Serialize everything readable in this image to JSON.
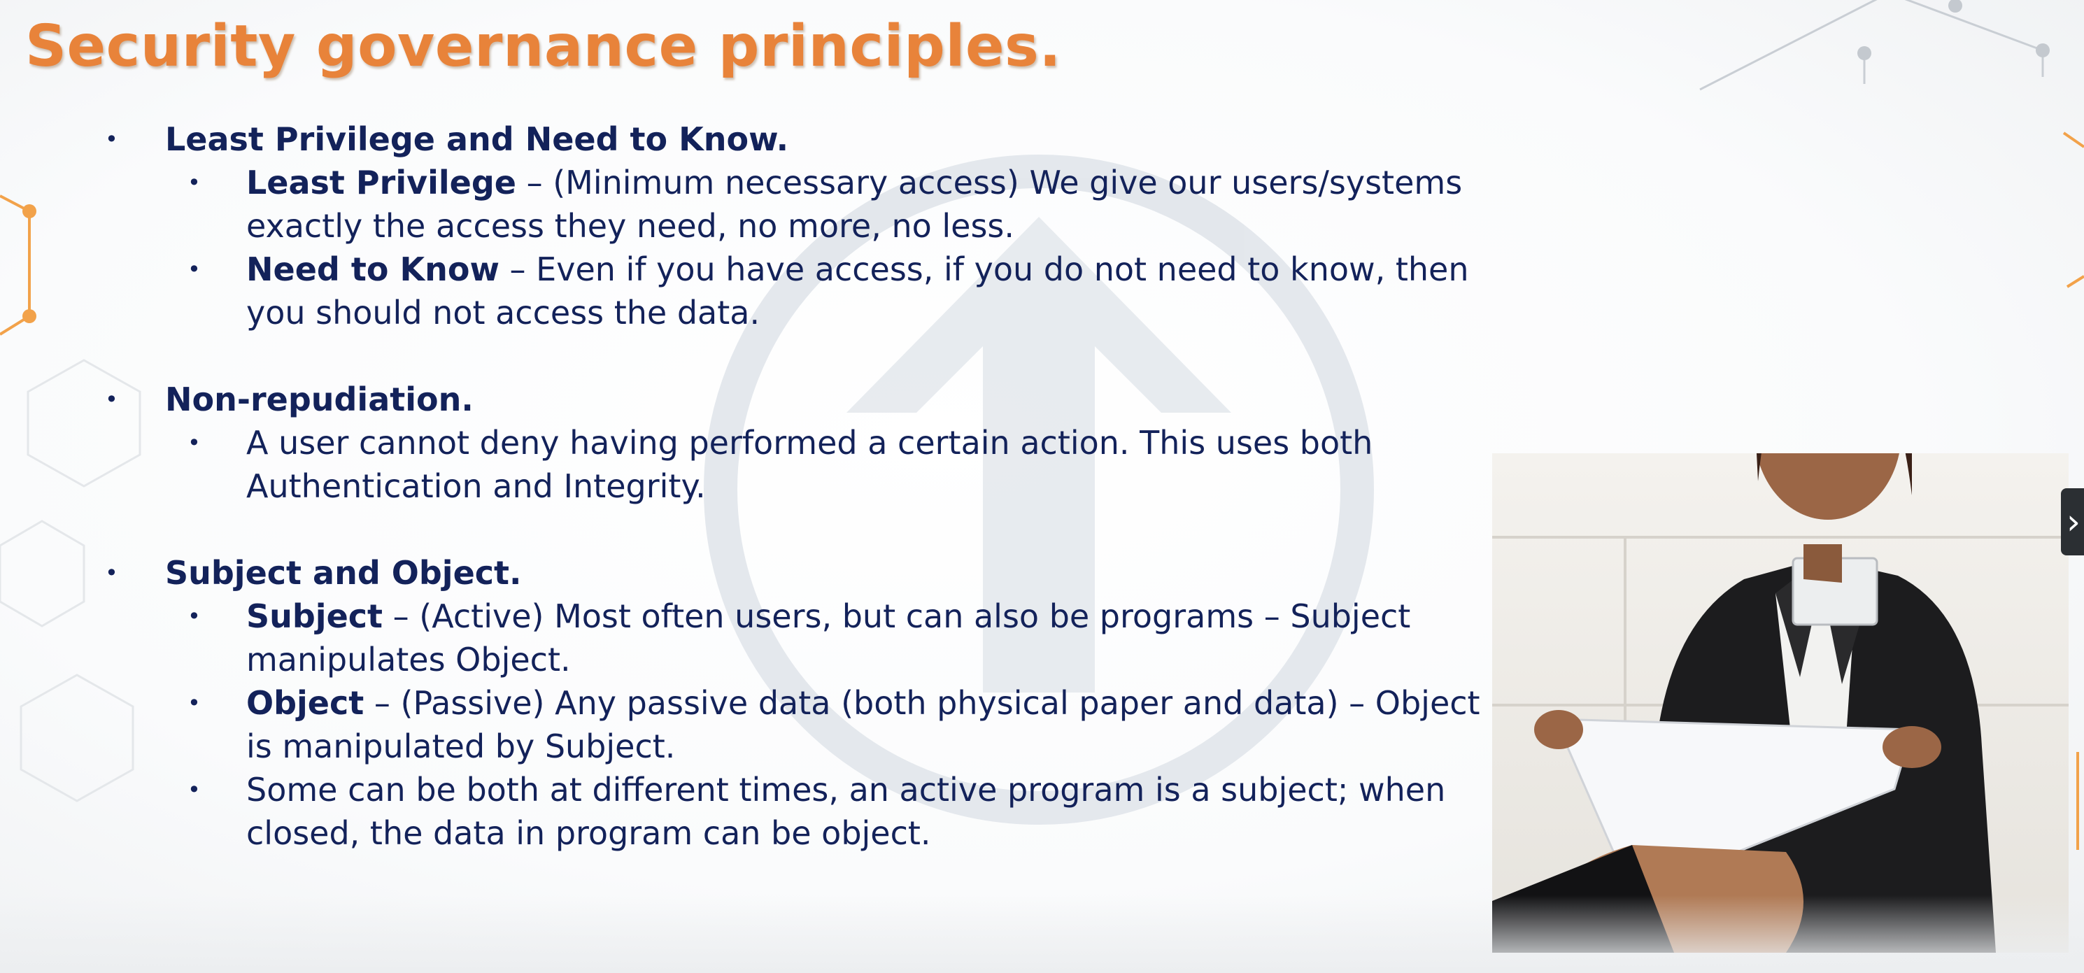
{
  "slide": {
    "title": "Security governance principles.",
    "sections": [
      {
        "heading": "Least Privilege and Need to Know.",
        "items": [
          {
            "line1_term": "Least Privilege",
            "line1_rest": " – (Minimum necessary access) We give our users/systems",
            "line2": "exactly the access they need, no more, no less."
          },
          {
            "line1_term": "Need to Know",
            "line1_rest": " – Even if you have access, if you do not need to know, then",
            "line2": "you should not access the data."
          }
        ]
      },
      {
        "heading": "Non-repudiation.",
        "items": [
          {
            "line1_term": "",
            "line1_rest": "A user cannot deny having performed a certain action. This uses both",
            "line2": "Authentication and Integrity."
          }
        ]
      },
      {
        "heading": "Subject and Object.",
        "items": [
          {
            "line1_term": "Subject",
            "line1_rest": " – (Active) Most often users, but can also be programs – Subject",
            "line2": "manipulates Object."
          },
          {
            "line1_term": "Object",
            "line1_rest": " – (Passive) Any passive data (both physical paper and data) – Object",
            "line2": "is manipulated by Subject."
          },
          {
            "line1_term": "",
            "line1_rest": "Some can be both at different times, an active program is a subject; when",
            "line2": "closed, the data in program can be object."
          }
        ]
      }
    ],
    "bullet_glyph": "•",
    "image_icon": "businesswoman-with-document-photo"
  },
  "controls": {
    "next_icon": "chevron-right-icon",
    "next_glyph": "›"
  },
  "colors": {
    "title": "#e8833a",
    "text": "#13225a",
    "watermark": "#dfe4ea",
    "accent_lines": "#f2a24a"
  }
}
